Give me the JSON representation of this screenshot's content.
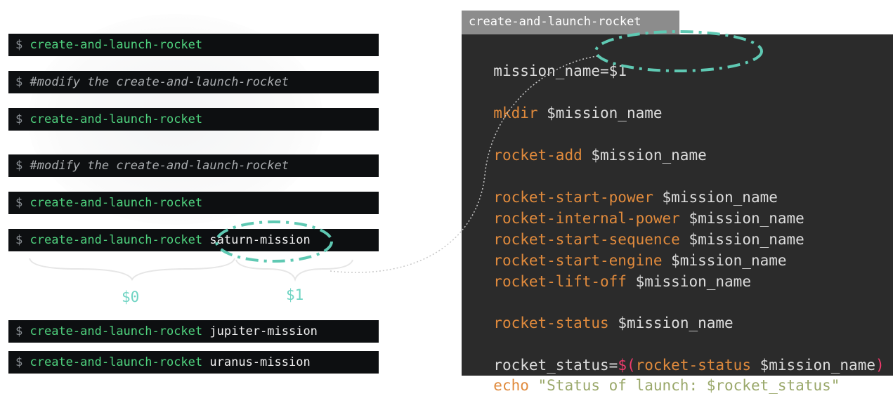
{
  "prompt": "$",
  "terminal_lines": [
    {
      "cmd": "create-and-launch-rocket",
      "comment": "",
      "arg": ""
    },
    {
      "cmd": "",
      "comment": "#modify the create-and-launch-rocket",
      "arg": ""
    },
    {
      "cmd": "create-and-launch-rocket",
      "comment": "",
      "arg": ""
    },
    {
      "cmd": "",
      "comment": "#modify the create-and-launch-rocket",
      "arg": ""
    },
    {
      "cmd": "create-and-launch-rocket",
      "comment": "",
      "arg": ""
    },
    {
      "cmd": "create-and-launch-rocket",
      "comment": "",
      "arg": "saturn-mission"
    },
    {
      "cmd": "create-and-launch-rocket",
      "comment": "",
      "arg": "jupiter-mission"
    },
    {
      "cmd": "create-and-launch-rocket",
      "comment": "",
      "arg": "uranus-mission"
    }
  ],
  "positional_labels": {
    "zero": "$0",
    "one": "$1"
  },
  "editor": {
    "tab_title": "create-and-launch-rocket",
    "lines": [
      {
        "a": "mission_name=",
        "b": "$1",
        "c": ""
      },
      {
        "a": "mkdir",
        "b": " $mission_name",
        "c": ""
      },
      {
        "a": "rocket-add",
        "b": " $mission_name",
        "c": ""
      },
      {
        "a": "rocket-start-power",
        "b": " $mission_name",
        "c": ""
      },
      {
        "a": "rocket-internal-power",
        "b": " $mission_name",
        "c": ""
      },
      {
        "a": "rocket-start-sequence",
        "b": " $mission_name",
        "c": ""
      },
      {
        "a": "rocket-start-engine",
        "b": " $mission_name",
        "c": ""
      },
      {
        "a": "rocket-lift-off",
        "b": " $mission_name",
        "c": ""
      },
      {
        "a": "rocket-status",
        "b": " $mission_name",
        "c": ""
      },
      {
        "a": "rocket_status=",
        "b": "$(",
        "c": "rocket-status",
        "d": " $mission_name",
        "e": ")"
      },
      {
        "a": "echo",
        "b": " \"Status of launch: $rocket_status\"",
        "c": ""
      }
    ]
  },
  "colors": {
    "terminal_bg": "#0d0f11",
    "command": "#4fd27e",
    "editor_bg": "#2b2b2b",
    "keyword": "#e08a3c",
    "highlight": "#5fc9b3"
  }
}
